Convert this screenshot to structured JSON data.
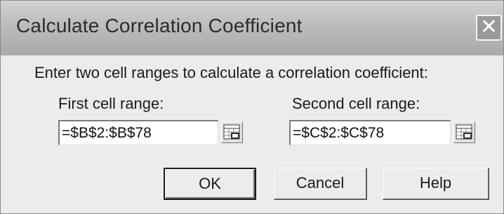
{
  "dialog": {
    "title": "Calculate Correlation Coefficient",
    "close_glyph": "✕",
    "instructions": "Enter two cell ranges to calculate a correlation coefficient:"
  },
  "fields": {
    "first": {
      "label": "First cell range:",
      "value": "=$B$2:$B$78",
      "picker_icon": "range-picker-icon"
    },
    "second": {
      "label": "Second cell range:",
      "value": "=$C$2:$C$78",
      "picker_icon": "range-picker-icon"
    }
  },
  "buttons": {
    "ok": "OK",
    "cancel": "Cancel",
    "help": "Help"
  }
}
